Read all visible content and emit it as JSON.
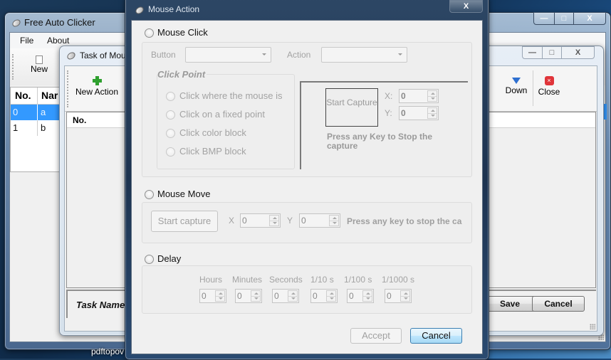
{
  "main_window": {
    "title": "Free Auto Clicker",
    "menu": [
      "File",
      "About"
    ],
    "toolbar": {
      "new_label": "New"
    },
    "table": {
      "columns": [
        "No.",
        "Nar"
      ],
      "rows": [
        {
          "no": "0",
          "name": "a",
          "selected": true
        },
        {
          "no": "1",
          "name": "b",
          "selected": false
        }
      ]
    },
    "caption_buttons": {
      "minimize": "—",
      "maximize": "□",
      "close": "X"
    }
  },
  "task_window": {
    "title": "Task of Mou",
    "toolbar": {
      "new_action_label": "New Action",
      "down_label": "Down",
      "close_label": "Close"
    },
    "table": {
      "columns": [
        "No."
      ]
    },
    "task_name_label": "Task Name",
    "save_label": "Save",
    "cancel_label": "Cancel",
    "caption_buttons": {
      "minimize": "—",
      "maximize": "□",
      "close": "X"
    }
  },
  "dialog": {
    "title": "Mouse Action",
    "close_label": "X",
    "mouse_click": {
      "label": "Mouse Click",
      "selected": false,
      "button_label": "Button",
      "button_value": "",
      "action_label": "Action",
      "action_value": "",
      "click_point": {
        "title": "Click Point",
        "options": [
          "Click where the mouse is",
          "Click on a fixed point",
          "Click color block",
          "Click BMP block"
        ]
      },
      "capture": {
        "start_label": "Start Capture",
        "x_label": "X:",
        "x_value": "0",
        "y_label": "Y:",
        "y_value": "0",
        "hint": "Press any Key to Stop the capture"
      }
    },
    "mouse_move": {
      "label": "Mouse Move",
      "selected": false,
      "start_label": "Start capture",
      "x_label": "X",
      "x_value": "0",
      "y_label": "Y",
      "y_value": "0",
      "hint": "Press any key to stop the ca"
    },
    "delay": {
      "label": "Delay",
      "selected": false,
      "fields": [
        {
          "label": "Hours",
          "value": "0"
        },
        {
          "label": "Minutes",
          "value": "0"
        },
        {
          "label": "Seconds",
          "value": "0"
        },
        {
          "label": "1/10 s",
          "value": "0"
        },
        {
          "label": "1/100 s",
          "value": "0"
        },
        {
          "label": "1/1000 s",
          "value": "0"
        }
      ]
    },
    "accept_label": "Accept",
    "cancel_label": "Cancel"
  },
  "taskbar": {
    "item_label": "pdftopov"
  },
  "colors": {
    "selection": "#3399ff",
    "disabled_text": "#a3a3a3",
    "dialog_bg": "#f0f0f0"
  }
}
